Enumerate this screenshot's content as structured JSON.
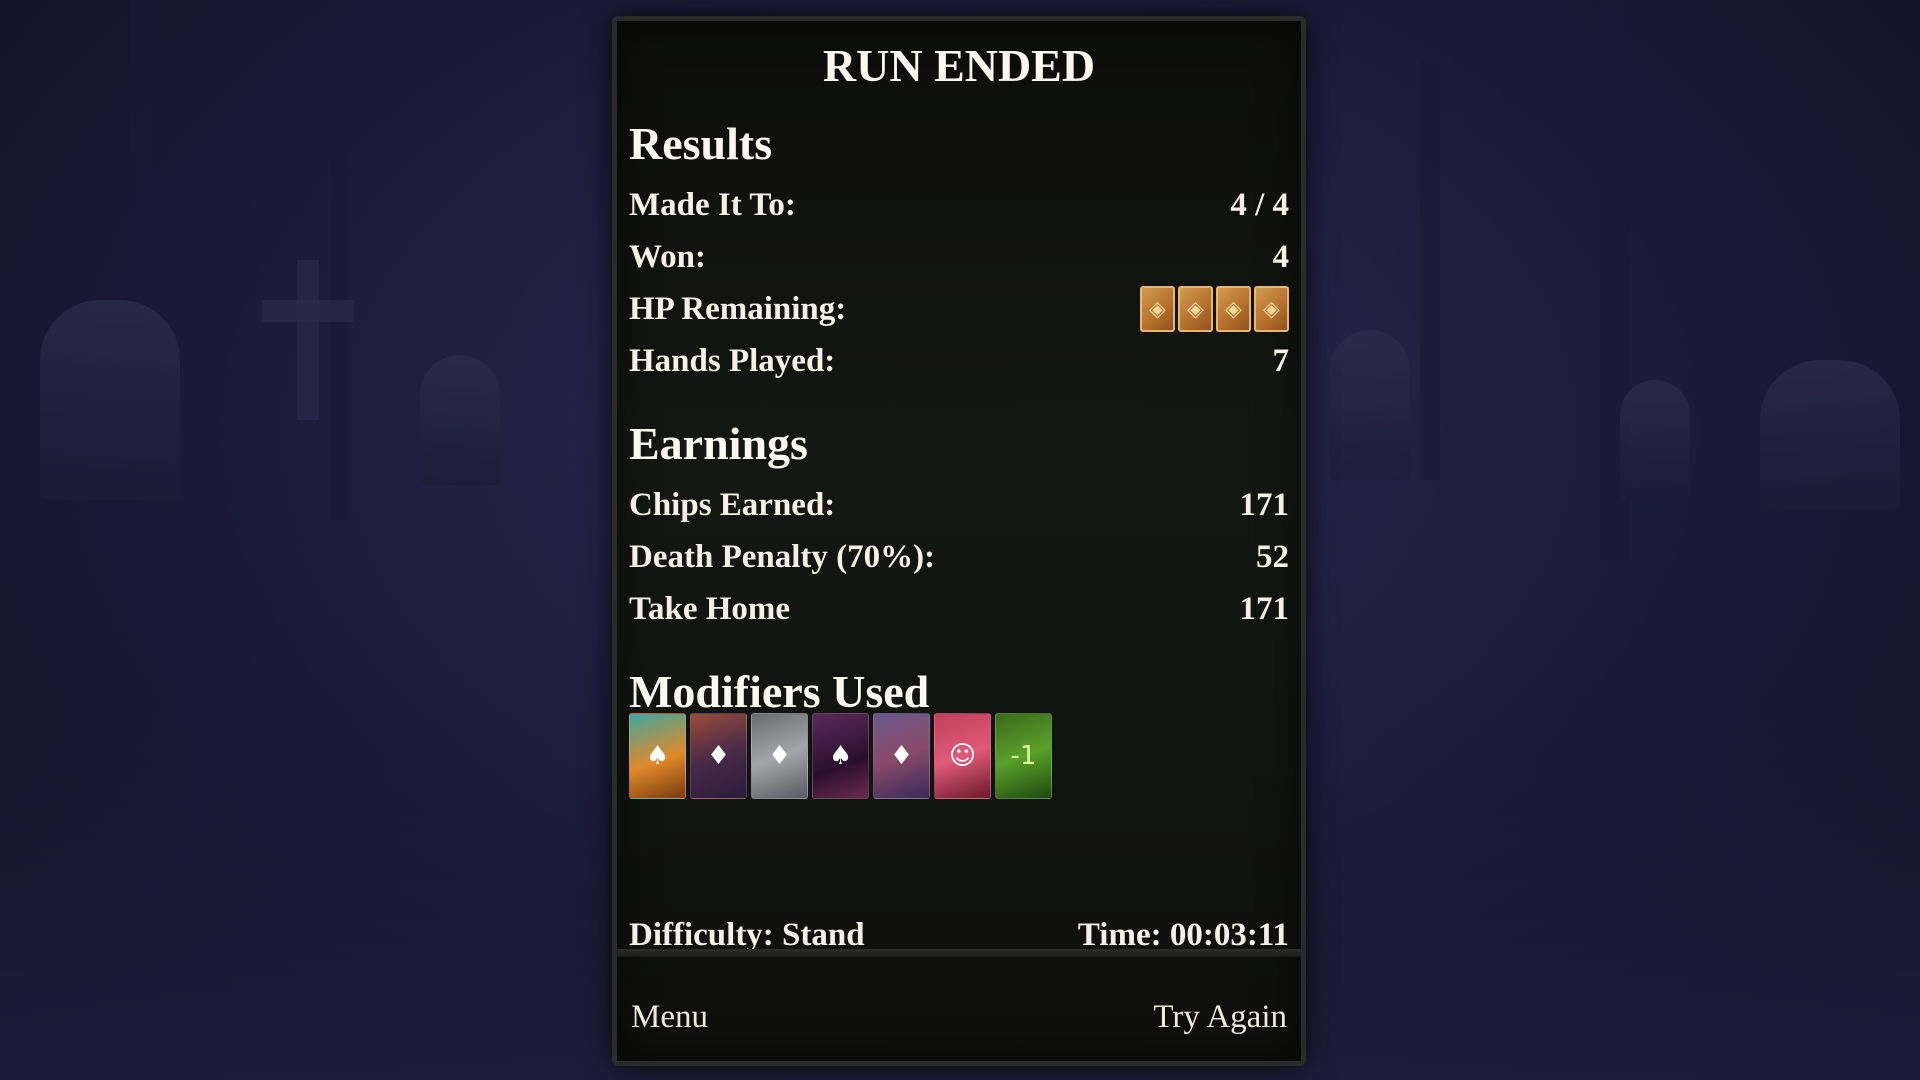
{
  "title": "RUN ENDED",
  "results": {
    "heading": "Results",
    "made_it_to_label": "Made It To:",
    "made_it_to_value": "4 / 4",
    "won_label": "Won:",
    "won_value": "4",
    "hp_label": "HP Remaining:",
    "hp_remaining": 4,
    "hands_played_label": "Hands Played:",
    "hands_played_value": "7"
  },
  "earnings": {
    "heading": "Earnings",
    "chips_earned_label": "Chips Earned:",
    "chips_earned_value": "171",
    "death_penalty_label": "Death Penalty (70%):",
    "death_penalty_value": "52",
    "take_home_label": "Take Home",
    "take_home_value": "171"
  },
  "modifiers": {
    "heading": "Modifiers Used",
    "count": 7,
    "icons": [
      "modifier-card-icon",
      "modifier-card-icon",
      "modifier-card-icon",
      "modifier-card-icon",
      "modifier-card-icon",
      "modifier-card-icon",
      "modifier-card-icon"
    ],
    "last_card_text": "-1"
  },
  "footer": {
    "difficulty": "Difficulty: Stand",
    "time": "Time: 00:03:11"
  },
  "buttons": {
    "menu": "Menu",
    "try_again": "Try Again"
  }
}
